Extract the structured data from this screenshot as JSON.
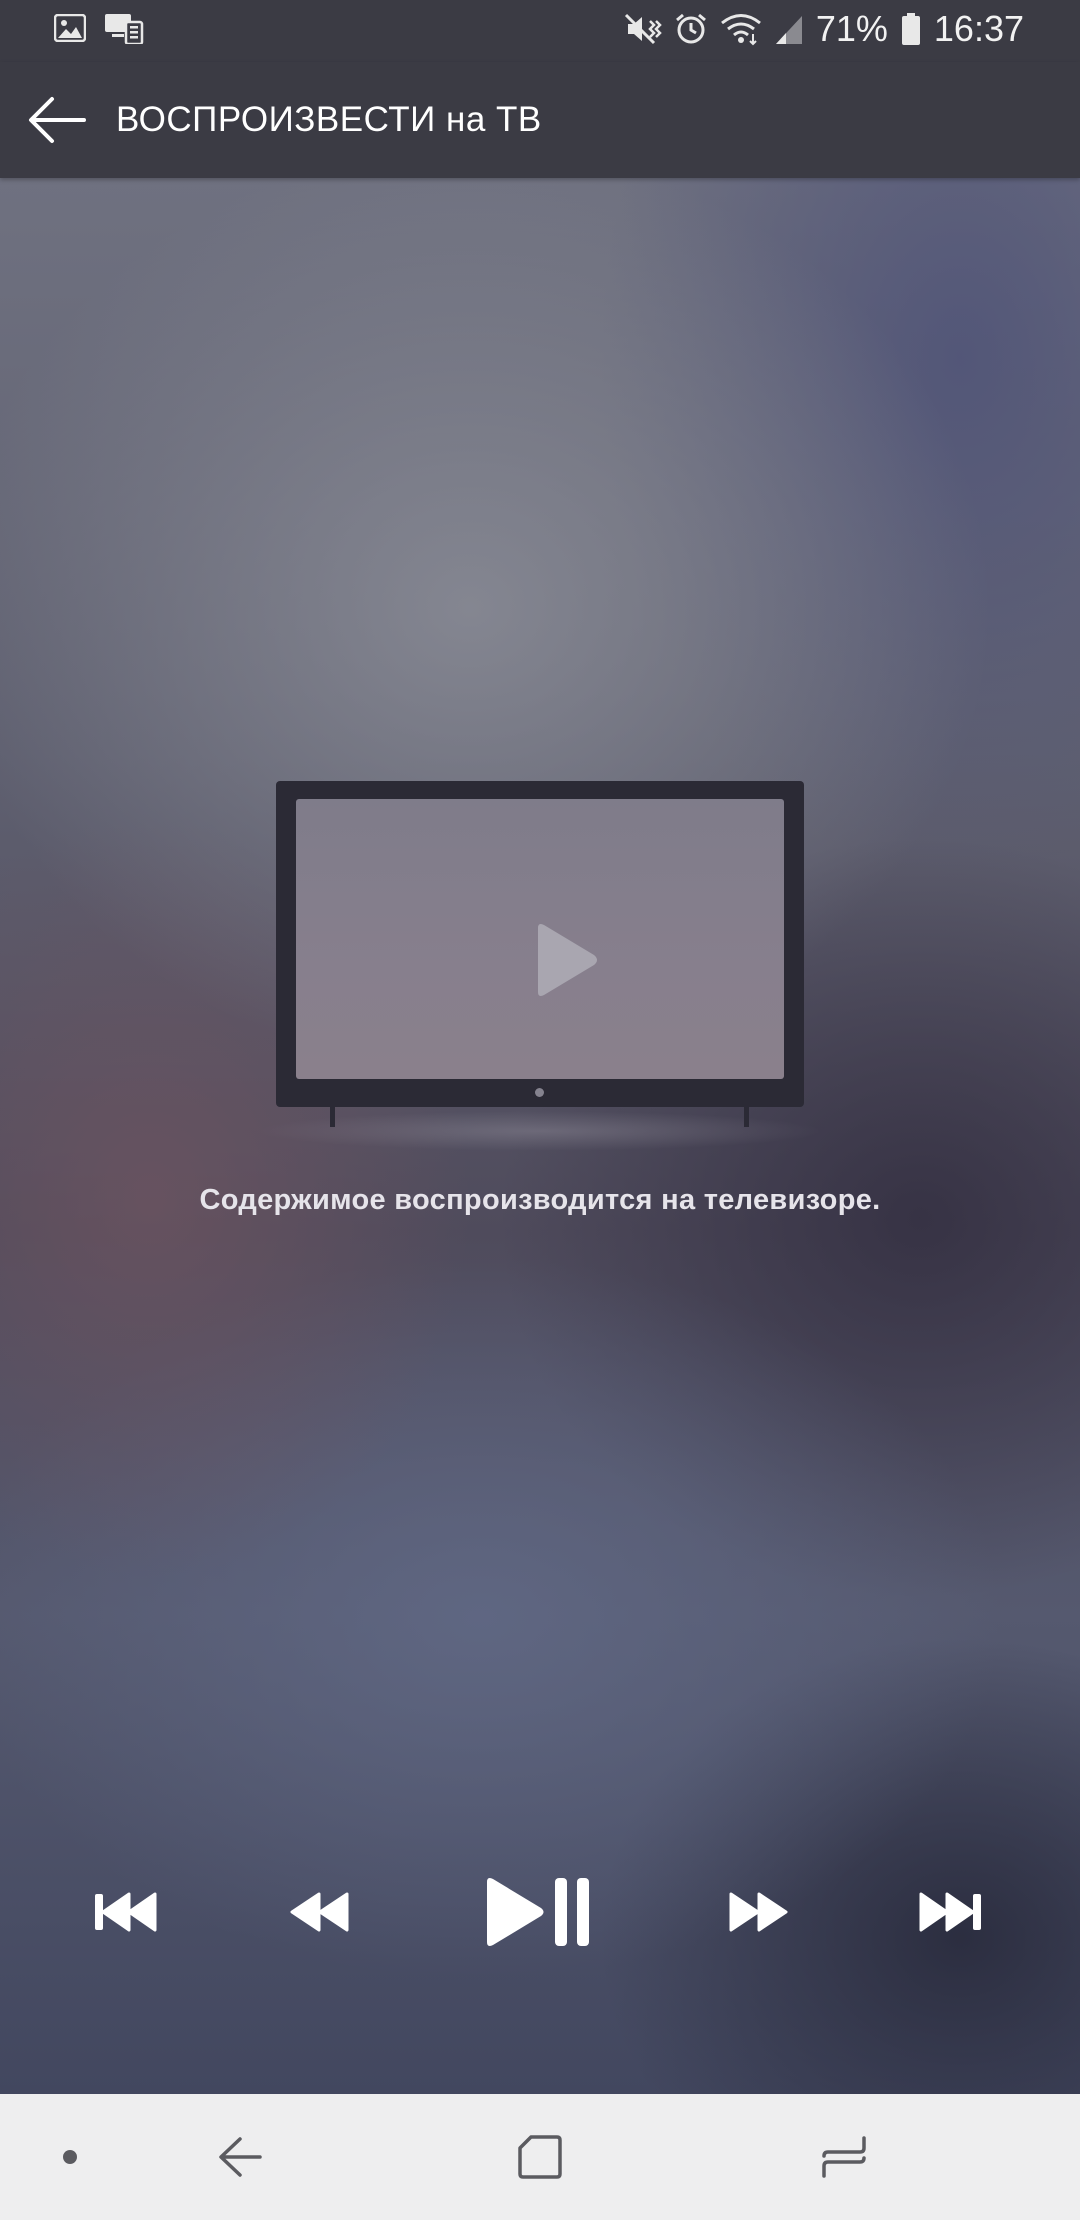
{
  "status_bar": {
    "icons_left": [
      "image-icon",
      "cast-devices-icon"
    ],
    "icons_right": [
      "mute-vibrate-icon",
      "alarm-icon",
      "wifi-icon",
      "signal-icon",
      "battery-icon"
    ],
    "battery_percent": "71%",
    "time": "16:37"
  },
  "app_bar": {
    "title": "ВОСПРОИЗВЕСТИ на ТВ",
    "back_icon": "arrow-left-icon"
  },
  "main": {
    "tv_icon": "tv-icon",
    "play_icon": "play-icon",
    "message": "Содержимое воспроизводится на телевизоре."
  },
  "controls": [
    {
      "name": "skip-previous-button",
      "icon": "skip-previous-icon"
    },
    {
      "name": "rewind-button",
      "icon": "rewind-icon"
    },
    {
      "name": "play-pause-button",
      "icon": "play-pause-icon"
    },
    {
      "name": "fast-forward-button",
      "icon": "fast-forward-icon"
    },
    {
      "name": "skip-next-button",
      "icon": "skip-next-icon"
    }
  ],
  "nav_bar": {
    "buttons": [
      "dot-icon",
      "back-icon",
      "home-icon",
      "recents-icon"
    ]
  },
  "colors": {
    "bar_background": "#3b3b44",
    "nav_background": "#eeeeef",
    "controls_color": "#ffffff",
    "message_color": "#e6e4ea"
  }
}
